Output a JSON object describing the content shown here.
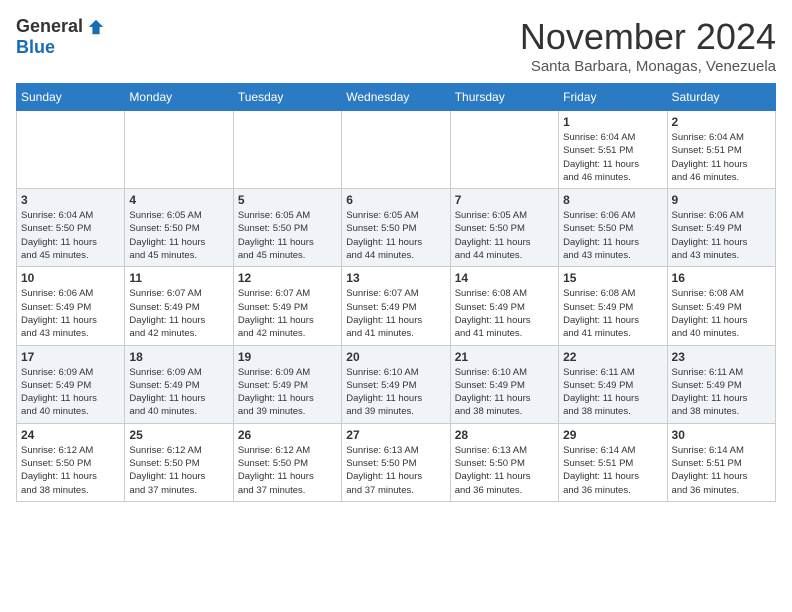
{
  "header": {
    "logo_general": "General",
    "logo_blue": "Blue",
    "month": "November 2024",
    "location": "Santa Barbara, Monagas, Venezuela"
  },
  "weekdays": [
    "Sunday",
    "Monday",
    "Tuesday",
    "Wednesday",
    "Thursday",
    "Friday",
    "Saturday"
  ],
  "weeks": [
    [
      {
        "day": "",
        "info": ""
      },
      {
        "day": "",
        "info": ""
      },
      {
        "day": "",
        "info": ""
      },
      {
        "day": "",
        "info": ""
      },
      {
        "day": "",
        "info": ""
      },
      {
        "day": "1",
        "info": "Sunrise: 6:04 AM\nSunset: 5:51 PM\nDaylight: 11 hours\nand 46 minutes."
      },
      {
        "day": "2",
        "info": "Sunrise: 6:04 AM\nSunset: 5:51 PM\nDaylight: 11 hours\nand 46 minutes."
      }
    ],
    [
      {
        "day": "3",
        "info": "Sunrise: 6:04 AM\nSunset: 5:50 PM\nDaylight: 11 hours\nand 45 minutes."
      },
      {
        "day": "4",
        "info": "Sunrise: 6:05 AM\nSunset: 5:50 PM\nDaylight: 11 hours\nand 45 minutes."
      },
      {
        "day": "5",
        "info": "Sunrise: 6:05 AM\nSunset: 5:50 PM\nDaylight: 11 hours\nand 45 minutes."
      },
      {
        "day": "6",
        "info": "Sunrise: 6:05 AM\nSunset: 5:50 PM\nDaylight: 11 hours\nand 44 minutes."
      },
      {
        "day": "7",
        "info": "Sunrise: 6:05 AM\nSunset: 5:50 PM\nDaylight: 11 hours\nand 44 minutes."
      },
      {
        "day": "8",
        "info": "Sunrise: 6:06 AM\nSunset: 5:50 PM\nDaylight: 11 hours\nand 43 minutes."
      },
      {
        "day": "9",
        "info": "Sunrise: 6:06 AM\nSunset: 5:49 PM\nDaylight: 11 hours\nand 43 minutes."
      }
    ],
    [
      {
        "day": "10",
        "info": "Sunrise: 6:06 AM\nSunset: 5:49 PM\nDaylight: 11 hours\nand 43 minutes."
      },
      {
        "day": "11",
        "info": "Sunrise: 6:07 AM\nSunset: 5:49 PM\nDaylight: 11 hours\nand 42 minutes."
      },
      {
        "day": "12",
        "info": "Sunrise: 6:07 AM\nSunset: 5:49 PM\nDaylight: 11 hours\nand 42 minutes."
      },
      {
        "day": "13",
        "info": "Sunrise: 6:07 AM\nSunset: 5:49 PM\nDaylight: 11 hours\nand 41 minutes."
      },
      {
        "day": "14",
        "info": "Sunrise: 6:08 AM\nSunset: 5:49 PM\nDaylight: 11 hours\nand 41 minutes."
      },
      {
        "day": "15",
        "info": "Sunrise: 6:08 AM\nSunset: 5:49 PM\nDaylight: 11 hours\nand 41 minutes."
      },
      {
        "day": "16",
        "info": "Sunrise: 6:08 AM\nSunset: 5:49 PM\nDaylight: 11 hours\nand 40 minutes."
      }
    ],
    [
      {
        "day": "17",
        "info": "Sunrise: 6:09 AM\nSunset: 5:49 PM\nDaylight: 11 hours\nand 40 minutes."
      },
      {
        "day": "18",
        "info": "Sunrise: 6:09 AM\nSunset: 5:49 PM\nDaylight: 11 hours\nand 40 minutes."
      },
      {
        "day": "19",
        "info": "Sunrise: 6:09 AM\nSunset: 5:49 PM\nDaylight: 11 hours\nand 39 minutes."
      },
      {
        "day": "20",
        "info": "Sunrise: 6:10 AM\nSunset: 5:49 PM\nDaylight: 11 hours\nand 39 minutes."
      },
      {
        "day": "21",
        "info": "Sunrise: 6:10 AM\nSunset: 5:49 PM\nDaylight: 11 hours\nand 38 minutes."
      },
      {
        "day": "22",
        "info": "Sunrise: 6:11 AM\nSunset: 5:49 PM\nDaylight: 11 hours\nand 38 minutes."
      },
      {
        "day": "23",
        "info": "Sunrise: 6:11 AM\nSunset: 5:49 PM\nDaylight: 11 hours\nand 38 minutes."
      }
    ],
    [
      {
        "day": "24",
        "info": "Sunrise: 6:12 AM\nSunset: 5:50 PM\nDaylight: 11 hours\nand 38 minutes."
      },
      {
        "day": "25",
        "info": "Sunrise: 6:12 AM\nSunset: 5:50 PM\nDaylight: 11 hours\nand 37 minutes."
      },
      {
        "day": "26",
        "info": "Sunrise: 6:12 AM\nSunset: 5:50 PM\nDaylight: 11 hours\nand 37 minutes."
      },
      {
        "day": "27",
        "info": "Sunrise: 6:13 AM\nSunset: 5:50 PM\nDaylight: 11 hours\nand 37 minutes."
      },
      {
        "day": "28",
        "info": "Sunrise: 6:13 AM\nSunset: 5:50 PM\nDaylight: 11 hours\nand 36 minutes."
      },
      {
        "day": "29",
        "info": "Sunrise: 6:14 AM\nSunset: 5:51 PM\nDaylight: 11 hours\nand 36 minutes."
      },
      {
        "day": "30",
        "info": "Sunrise: 6:14 AM\nSunset: 5:51 PM\nDaylight: 11 hours\nand 36 minutes."
      }
    ]
  ]
}
